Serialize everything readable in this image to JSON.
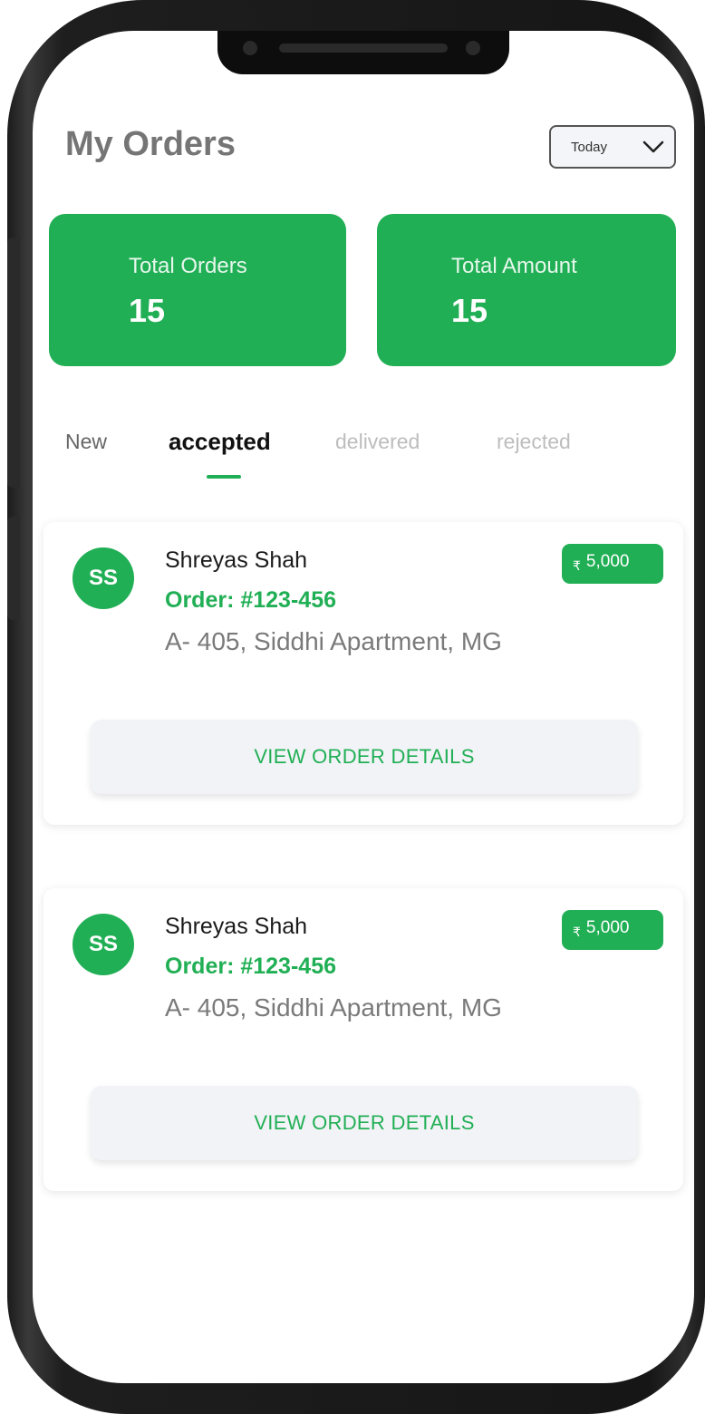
{
  "header": {
    "title": "My Orders",
    "date_filter": {
      "value": "Today",
      "icon": "chevron-down-icon"
    }
  },
  "stats": [
    {
      "label": "Total Orders",
      "value": "15"
    },
    {
      "label": "Total Amount",
      "value": "15"
    }
  ],
  "tabs": [
    {
      "label": "New",
      "active": false
    },
    {
      "label": "accepted",
      "active": true
    },
    {
      "label": "delivered",
      "active": false
    },
    {
      "label": "rejected",
      "active": false
    }
  ],
  "orders": [
    {
      "initials": "SS",
      "name": "Shreyas Shah",
      "order_no": "Order: #123-456",
      "address": "A- 405, Siddhi Apartment, MG",
      "currency": "₹",
      "amount": "5,000",
      "action_label": "VIEW ORDER DETAILS"
    },
    {
      "initials": "SS",
      "name": "Shreyas Shah",
      "order_no": "Order: #123-456",
      "address": "A- 405, Siddhi Apartment, MG",
      "currency": "₹",
      "amount": "5,000",
      "action_label": "VIEW ORDER DETAILS"
    }
  ],
  "colors": {
    "accent": "#21af55",
    "title": "#757575",
    "muted": "#bdbdbd",
    "frame": "#1b1b1b"
  }
}
